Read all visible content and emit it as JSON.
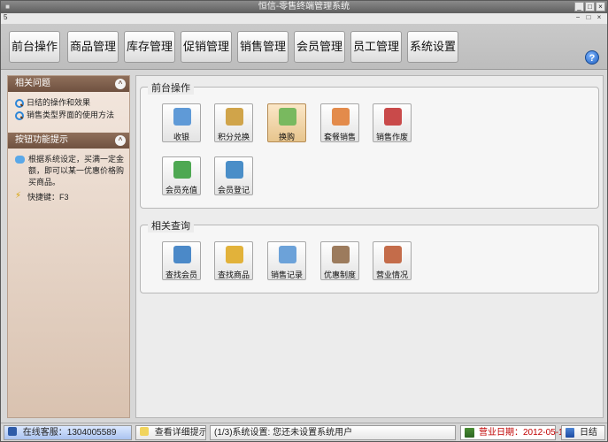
{
  "window": {
    "title": "恒信-零售终端管理系统",
    "controls": [
      "_",
      "□",
      "×"
    ]
  },
  "menubar": {
    "mark": "5",
    "mini_buttons": [
      "−",
      "□",
      "×"
    ]
  },
  "topnav": {
    "items": [
      {
        "label": "前台操作"
      },
      {
        "label": "商品管理"
      },
      {
        "label": "库存管理"
      },
      {
        "label": "促销管理"
      },
      {
        "label": "销售管理"
      },
      {
        "label": "会员管理"
      },
      {
        "label": "员工管理"
      },
      {
        "label": "系统设置"
      }
    ],
    "help_label": "?"
  },
  "sidebar": {
    "related_title": "相关问题",
    "related_items": [
      "日结的操作和效果",
      "销售类型界面的使用方法"
    ],
    "tips_title": "按钮功能提示",
    "tips_text": "根据系统设定，买满一定金额，即可以某一优惠价格购买商品。",
    "shortcut_text": "快捷键：F3",
    "collapse_icon": "^"
  },
  "main": {
    "front_title": "前台操作",
    "front_tiles": [
      {
        "label": "收银",
        "icon_color": "#5f9ad7"
      },
      {
        "label": "积分兑换",
        "icon_color": "#d0a44a"
      },
      {
        "label": "换购",
        "icon_color": "#79b95f"
      },
      {
        "label": "套餐销售",
        "icon_color": "#e38b4b"
      },
      {
        "label": "销售作废",
        "icon_color": "#c94a4a"
      },
      {
        "label": "会员充值",
        "icon_color": "#4ea852"
      },
      {
        "label": "会员登记",
        "icon_color": "#4a8ec8"
      }
    ],
    "query_title": "相关查询",
    "query_tiles": [
      {
        "label": "查找会员",
        "icon_color": "#4b89c8"
      },
      {
        "label": "查找商品",
        "icon_color": "#e2b23a"
      },
      {
        "label": "销售记录",
        "icon_color": "#6ca2d9"
      },
      {
        "label": "优惠制度",
        "icon_color": "#9c7b5d"
      },
      {
        "label": "营业情况",
        "icon_color": "#c46c4a"
      }
    ]
  },
  "statusbar": {
    "online_service": "在线客服：1304005589",
    "view_tip": "查看详细提示",
    "system_message": "(1/3)系统设置: 您还未设置系统用户",
    "business_date": "营业日期：2012-05-12",
    "daily_settlement": "日结"
  }
}
